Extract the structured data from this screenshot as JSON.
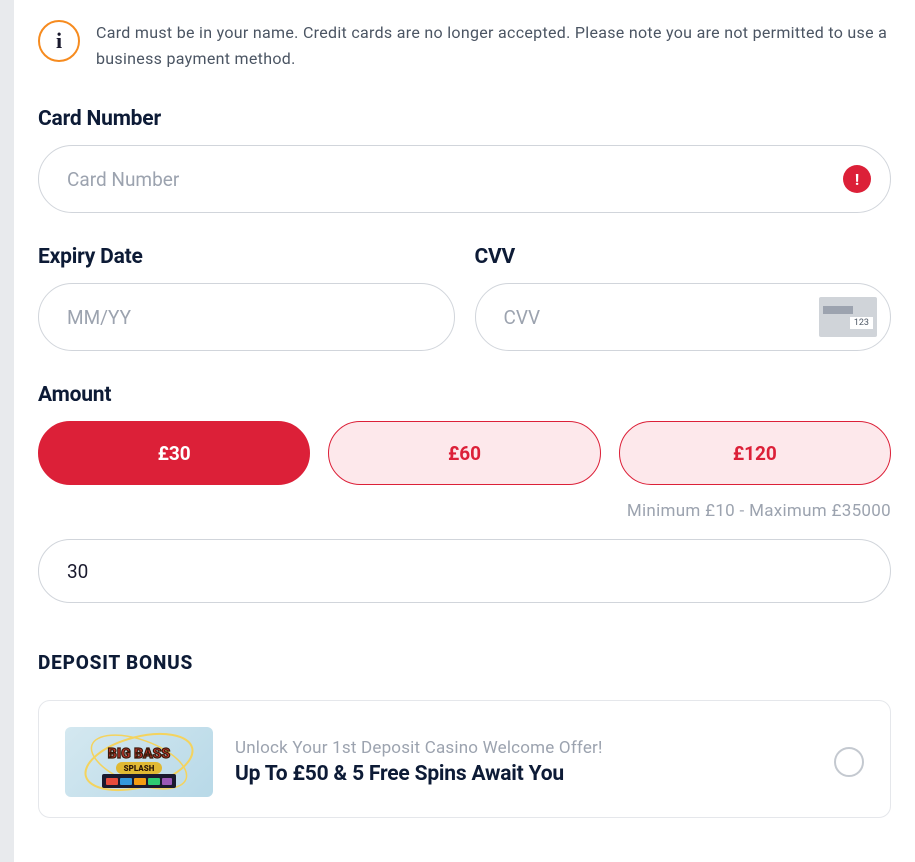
{
  "notice": {
    "text": "Card must be in your name. Credit cards are no longer accepted. Please note you are not permitted to use a business payment method."
  },
  "card_number": {
    "label": "Card Number",
    "placeholder": "Card Number"
  },
  "expiry": {
    "label": "Expiry Date",
    "placeholder": "MM/YY"
  },
  "cvv": {
    "label": "CVV",
    "placeholder": "CVV",
    "hint_digits": "123"
  },
  "amount": {
    "label": "Amount",
    "options": [
      "£30",
      "£60",
      "£120"
    ],
    "selected_index": 0,
    "min_max": "Minimum £10 - Maximum £35000",
    "value": "30"
  },
  "bonus": {
    "heading": "DEPOSIT BONUS",
    "subtitle": "Unlock Your 1st Deposit Casino Welcome Offer!",
    "title": "Up To £50 & 5 Free Spins Await You",
    "thumb_text_top": "BIG BASS",
    "thumb_text_bottom": "SPLASH"
  }
}
